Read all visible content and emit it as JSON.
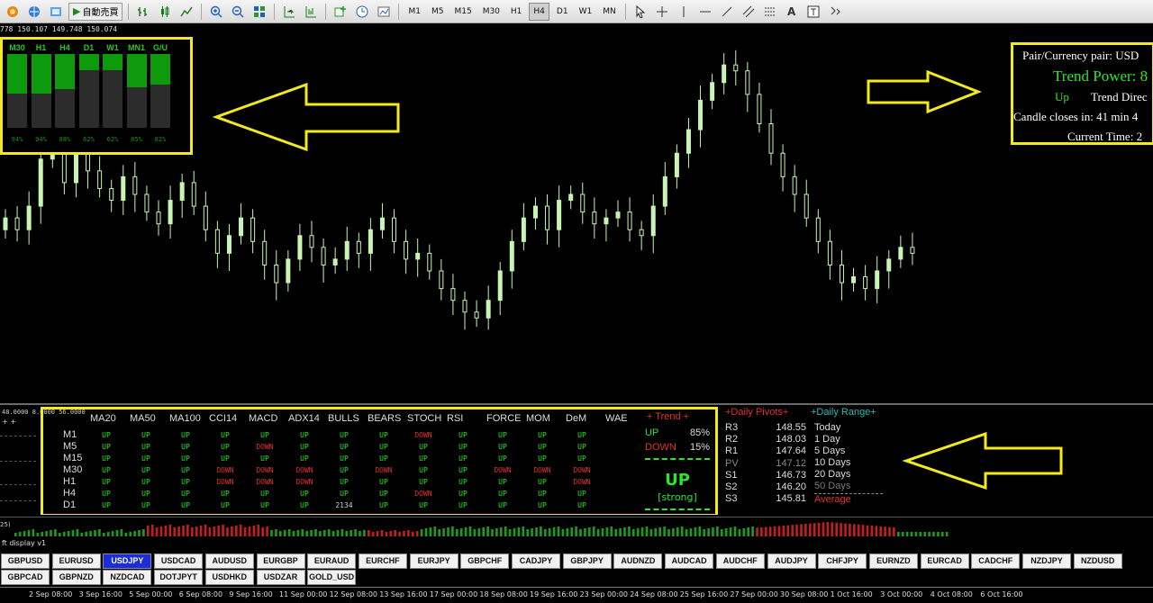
{
  "toolbar": {
    "auto_trade_label": "自動売買",
    "timeframes": [
      "M1",
      "M5",
      "M15",
      "M30",
      "H1",
      "H4",
      "D1",
      "W1",
      "MN"
    ],
    "active_timeframe": "H4"
  },
  "chart": {
    "ohlc_text": "778 150.107 149.748 150.074",
    "bull_color": "#c8f5b4",
    "bg_color": "#000000"
  },
  "strength_panel": {
    "columns": [
      {
        "label": "M30",
        "strength": 94,
        "pct_label": "94%"
      },
      {
        "label": "H1",
        "strength": 94,
        "pct_label": "94%"
      },
      {
        "label": "H4",
        "strength": 88,
        "pct_label": "88%"
      },
      {
        "label": "D1",
        "strength": 62,
        "pct_label": "62%"
      },
      {
        "label": "W1",
        "strength": 62,
        "pct_label": "62%"
      },
      {
        "label": "MN1",
        "strength": 85,
        "pct_label": "85%"
      },
      {
        "label": "G/U",
        "strength": 82,
        "pct_label": "82%"
      }
    ],
    "accent_color": "#f2ea1c"
  },
  "info_panel": {
    "pair_line": "Pair/Currency pair: USD",
    "trend_power": "Trend Power: 8",
    "direction_value": "Up",
    "direction_label": "Trend Direc",
    "candle_close": "Candle closes in: 41 min 4",
    "current_time": "Current Time: 2"
  },
  "sub_window": {
    "indicator_label": "48.0000 8.0000 56.0000",
    "columns": [
      "MA20",
      "MA50",
      "MA100",
      "CCI14",
      "MACD",
      "ADX14",
      "BULLS",
      "BEARS",
      "STOCH",
      "RSI",
      "FORCE",
      "MOM",
      "DeM",
      "WAE"
    ],
    "rows": [
      {
        "tf": "M1",
        "values": [
          "UP",
          "UP",
          "UP",
          "UP",
          "UP",
          "UP",
          "UP",
          "UP",
          "DOWN",
          "UP",
          "UP",
          "UP",
          "UP"
        ]
      },
      {
        "tf": "M5",
        "values": [
          "UP",
          "UP",
          "UP",
          "UP",
          "DOWN",
          "UP",
          "UP",
          "UP",
          "UP",
          "UP",
          "UP",
          "UP",
          "UP"
        ]
      },
      {
        "tf": "M15",
        "values": [
          "UP",
          "UP",
          "UP",
          "UP",
          "UP",
          "UP",
          "UP",
          "UP",
          "UP",
          "UP",
          "UP",
          "UP",
          "UP"
        ]
      },
      {
        "tf": "M30",
        "values": [
          "UP",
          "UP",
          "UP",
          "DOWN",
          "DOWN",
          "DOWN",
          "UP",
          "DOWN",
          "UP",
          "UP",
          "DOWN",
          "DOWN",
          "DOWN"
        ]
      },
      {
        "tf": "H1",
        "values": [
          "UP",
          "UP",
          "UP",
          "DOWN",
          "DOWN",
          "DOWN",
          "UP",
          "UP",
          "UP",
          "UP",
          "UP",
          "UP",
          "DOWN"
        ]
      },
      {
        "tf": "H4",
        "values": [
          "UP",
          "UP",
          "UP",
          "UP",
          "UP",
          "UP",
          "UP",
          "UP",
          "DOWN",
          "UP",
          "UP",
          "UP",
          "UP"
        ]
      },
      {
        "tf": "D1",
        "values": [
          "UP",
          "UP",
          "UP",
          "UP",
          "UP",
          "UP",
          "2134",
          "UP",
          "UP",
          "UP",
          "UP",
          "UP",
          "UP"
        ]
      }
    ],
    "trend_head": "+ Trend +",
    "trend_up_label": "UP",
    "trend_up_pct": "85%",
    "trend_down_label": "DOWN",
    "trend_down_pct": "15%",
    "trend_result": "UP",
    "trend_strength": "[strong]",
    "pivots_head": "+Daily Pivots+",
    "pivots": [
      {
        "label": "R3",
        "value": "148.55"
      },
      {
        "label": "R2",
        "value": "148.03"
      },
      {
        "label": "R1",
        "value": "147.64"
      },
      {
        "label": "PV",
        "value": "147.12"
      },
      {
        "label": "S1",
        "value": "146.73"
      },
      {
        "label": "S2",
        "value": "146.20"
      },
      {
        "label": "S3",
        "value": "145.81"
      }
    ],
    "range_head": "+Daily Range+",
    "range_items": [
      "Today",
      "1 Day",
      "5 Days",
      "10 Days",
      "20 Days",
      "50 Days"
    ],
    "range_avg": "Average"
  },
  "histogram": {
    "label": "25)"
  },
  "footer_label": "ft display v1",
  "pairs_row1": [
    "GBPUSD",
    "EURUSD",
    "USDJPY",
    "USDCAD",
    "AUDUSD",
    "EURGBP",
    "EURAUD",
    "EURCHF",
    "EURJPY",
    "GBPCHF",
    "CADJPY",
    "GBPJPY",
    "AUDNZD",
    "AUDCAD",
    "AUDCHF",
    "AUDJPY",
    "CHFJPY",
    "EURNZD",
    "EURCAD",
    "CADCHF",
    "NZDJPY",
    "NZDUSD"
  ],
  "pairs_row2": [
    "GBPCAD",
    "GBPNZD",
    "NZDCAD",
    "DOTJPYT",
    "USDHKD",
    "USDZAR",
    "GOLD_USD"
  ],
  "active_pair": "USDJPY",
  "time_axis": [
    "2 Sep 08:00",
    "3 Sep 16:00",
    "5 Sep 00:00",
    "6 Sep 08:00",
    "9 Sep 16:00",
    "11 Sep 00:00",
    "12 Sep 08:00",
    "13 Sep 16:00",
    "17 Sep 00:00",
    "18 Sep 08:00",
    "19 Sep 16:00",
    "23 Sep 00:00",
    "24 Sep 08:00",
    "25 Sep 16:00",
    "27 Sep 00:00",
    "30 Sep 08:00",
    "1 Oct 16:00",
    "3 Oct 00:00",
    "4 Oct 08:00",
    "6 Oct 16:00"
  ],
  "chart_data": {
    "type": "candlestick",
    "closes": [
      147.6,
      147.4,
      147.8,
      148.6,
      148.9,
      148.2,
      148.7,
      148.4,
      148.1,
      147.9,
      148.3,
      148.0,
      147.7,
      147.5,
      147.9,
      148.2,
      147.8,
      147.4,
      147.0,
      147.3,
      147.6,
      147.2,
      146.8,
      146.5,
      146.9,
      147.3,
      147.1,
      146.8,
      146.9,
      147.2,
      147.0,
      147.4,
      147.6,
      147.2,
      146.9,
      147.0,
      146.7,
      146.4,
      146.2,
      146.0,
      145.9,
      146.2,
      146.7,
      147.2,
      147.6,
      147.8,
      147.4,
      147.9,
      148.0,
      147.7,
      147.5,
      147.6,
      147.7,
      147.4,
      147.3,
      147.8,
      148.3,
      148.7,
      149.1,
      149.6,
      149.9,
      150.2,
      150.1,
      149.7,
      149.2,
      148.7,
      148.3,
      148.0,
      147.6,
      147.2,
      146.8,
      146.5,
      146.6,
      146.4,
      146.7,
      146.9,
      147.1,
      147.0
    ],
    "x_range_label": "2 Sep 08:00 – 6 Oct 16:00"
  }
}
